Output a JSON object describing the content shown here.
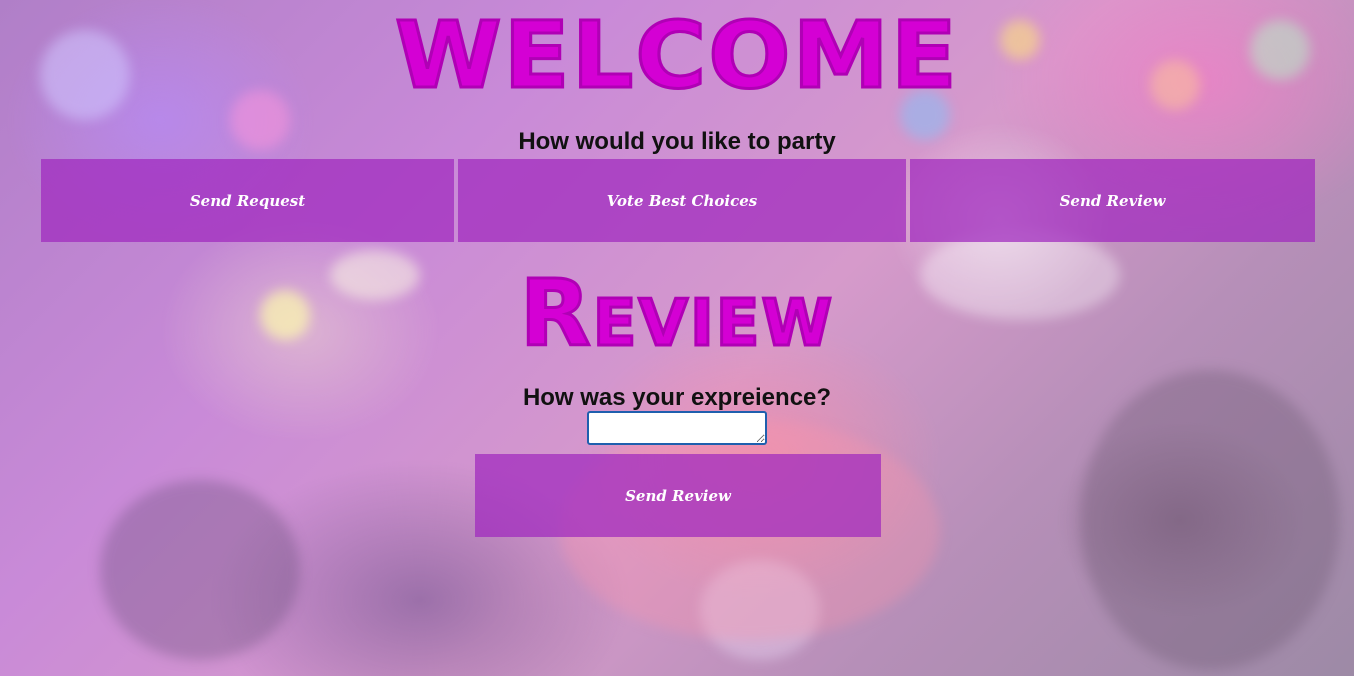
{
  "header": {
    "title": "WELCOME",
    "subtitle": "How would you like to party"
  },
  "nav": {
    "items": [
      {
        "label": "Send Request"
      },
      {
        "label": "Vote Best Choices"
      },
      {
        "label": "Send Review"
      }
    ]
  },
  "review": {
    "title": "Review",
    "prompt": "How was your expreience?",
    "textarea_value": "",
    "submit_label": "Send Review"
  },
  "colors": {
    "accent_title": "#d400d4",
    "button_background": "#a028be",
    "button_text": "#ffffff",
    "textarea_border": "#1f5fae"
  }
}
